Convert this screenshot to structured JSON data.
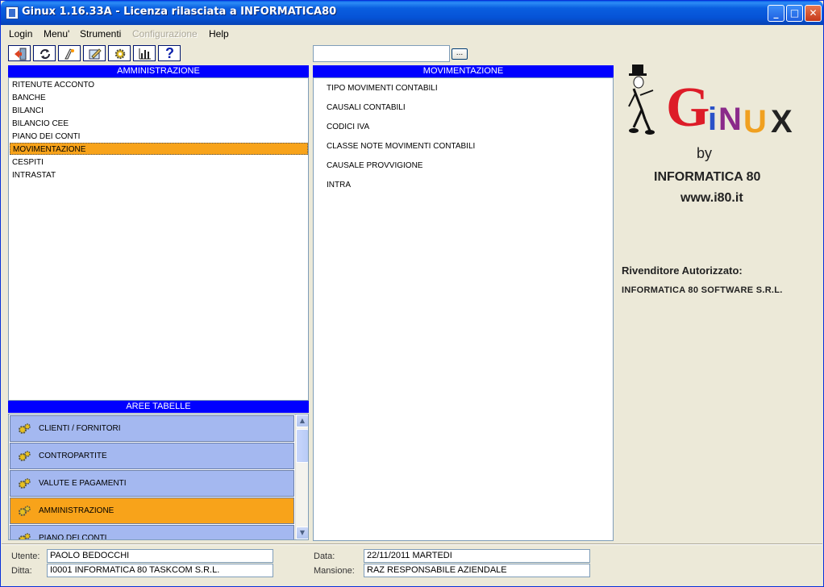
{
  "window": {
    "title": "Ginux 1.16.33A - Licenza rilasciata a INFORMATICA80",
    "controls": {
      "minimize": "_",
      "maximize": "□",
      "close": "✕"
    }
  },
  "menu": [
    {
      "label": "Login",
      "enabled": true
    },
    {
      "label": "Menu'",
      "enabled": true
    },
    {
      "label": "Strumenti",
      "enabled": true
    },
    {
      "label": "Configurazione",
      "enabled": false
    },
    {
      "label": "Help",
      "enabled": true
    }
  ],
  "toolbar": {
    "icons": [
      "exit-icon",
      "refresh-icon",
      "run-icon",
      "notes-icon",
      "gear-icon",
      "chart-icon",
      "help-icon"
    ],
    "help_glyph": "?",
    "search_value": "",
    "search_button_label": "..."
  },
  "amministrazione": {
    "header": "AMMINISTRAZIONE",
    "items": [
      "RITENUTE ACCONTO",
      "BANCHE",
      "BILANCI",
      "BILANCIO CEE",
      "PIANO DEI CONTI",
      "MOVIMENTAZIONE",
      "CESPITI",
      "INTRASTAT"
    ],
    "selected": "MOVIMENTAZIONE"
  },
  "movimentazione": {
    "header": "MOVIMENTAZIONE",
    "items": [
      "TIPO MOVIMENTI CONTABILI",
      "CAUSALI CONTABILI",
      "CODICI IVA",
      "CLASSE NOTE MOVIMENTI CONTABILI",
      "CAUSALE PROVVIGIONE",
      "INTRA"
    ]
  },
  "aree_tabelle": {
    "header": "AREE TABELLE",
    "items": [
      "CLIENTI / FORNITORI",
      "CONTROPARTITE",
      "VALUTE E PAGAMENTI",
      "AMMINISTRAZIONE",
      "PIANO DEI CONTI"
    ],
    "selected": "AMMINISTRAZIONE",
    "scroll_up": "▲",
    "scroll_down": "▼"
  },
  "branding": {
    "logo_letters": [
      "G",
      "i",
      "N",
      "U",
      "X"
    ],
    "logo_colors": [
      "#dd1c28",
      "#2a52c8",
      "#8a2a8a",
      "#f0a020",
      "#222222"
    ],
    "by": "by",
    "company": "INFORMATICA 80",
    "url": "www.i80.it",
    "reseller_label": "Rivenditore Autorizzato:",
    "reseller_name": "INFORMATICA 80 SOFTWARE S.R.L."
  },
  "footer": {
    "utente_label": "Utente:",
    "utente_value": "PAOLO BEDOCCHI",
    "ditta_label": "Ditta:",
    "ditta_value": "I0001 INFORMATICA 80 TASKCOM S.R.L.",
    "data_label": "Data:",
    "data_value": "22/11/2011 MARTEDI",
    "mansione_label": "Mansione:",
    "mansione_value": "RAZ RESPONSABILE AZIENDALE"
  },
  "colors": {
    "header_blue": "#0000ff",
    "selection_orange": "#f8a31a",
    "area_row_blue": "#a4b8f0"
  }
}
